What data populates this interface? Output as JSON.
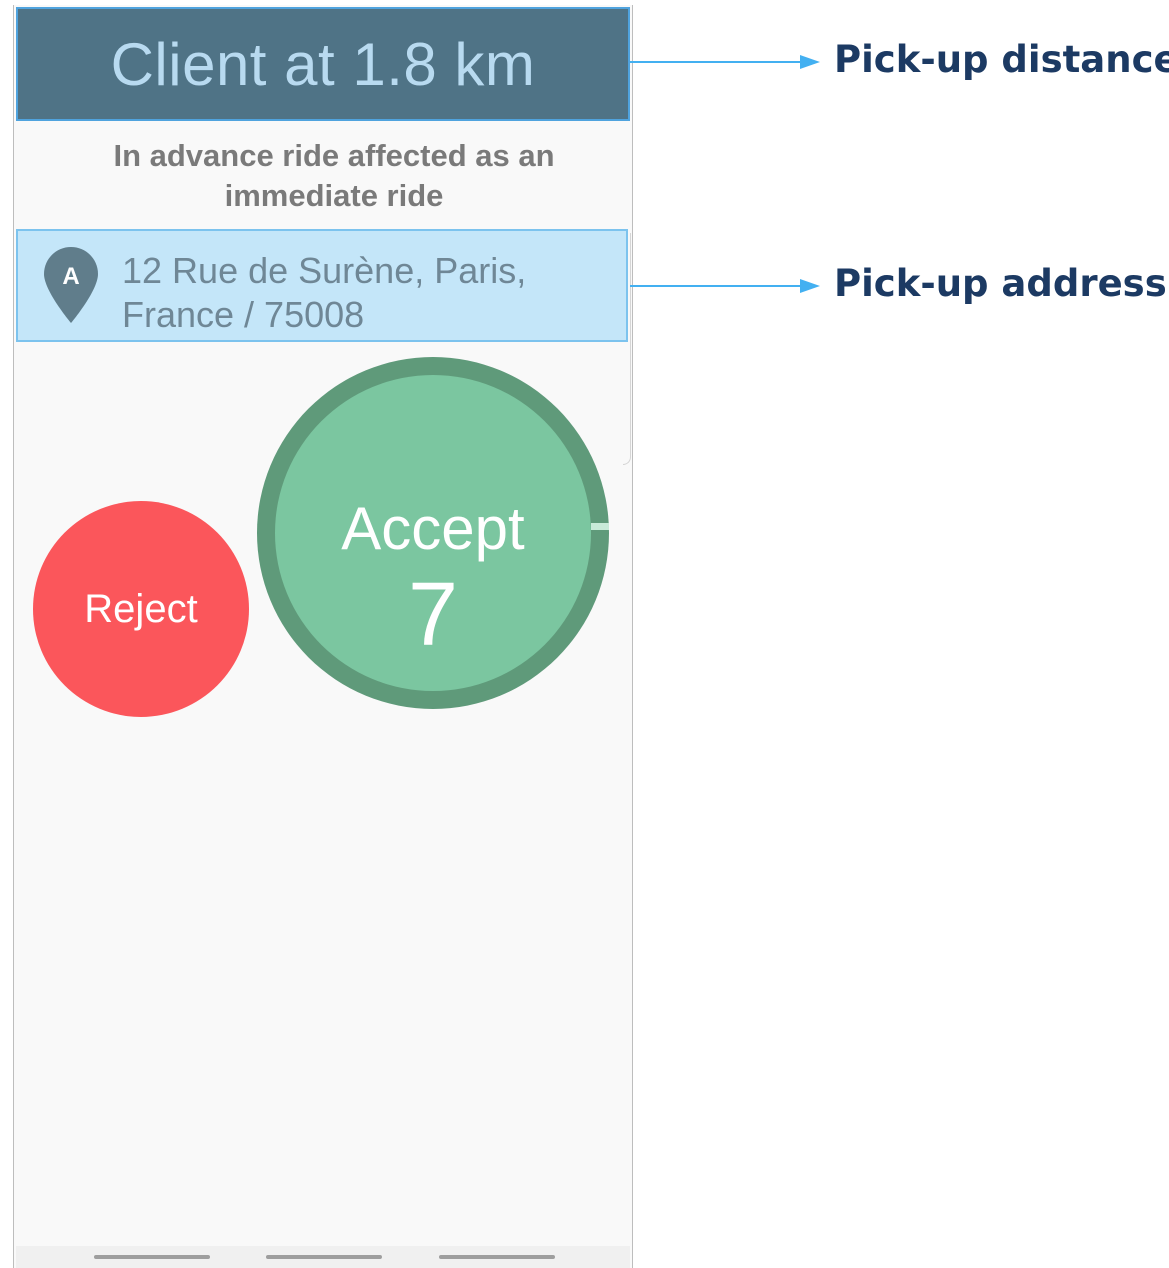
{
  "banner": {
    "distance_text": "Client at 1.8 km"
  },
  "notice": {
    "text": "In advance ride affected as an immediate ride"
  },
  "address": {
    "pin_letter": "A",
    "text": "12 Rue de Surène, Paris, France / 75008"
  },
  "actions": {
    "reject_label": "Reject",
    "accept_label": "Accept",
    "accept_countdown": "7"
  },
  "callouts": {
    "distance": "Pick-up distance",
    "address": "Pick-up address"
  },
  "colors": {
    "banner_bg": "#4f7386",
    "banner_text": "#b8daf0",
    "address_bg": "#c4e6f9",
    "reject": "#fb565b",
    "accept_fill": "#7bc6a0",
    "accept_ring": "#5f9a7a",
    "callout_text": "#1c3a63",
    "arrow": "#43b0f1"
  },
  "icons": {
    "pin": "map-pin-icon"
  }
}
